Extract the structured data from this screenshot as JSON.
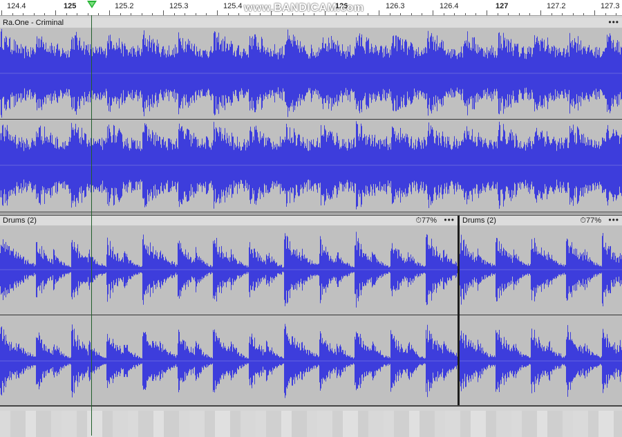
{
  "ruler": {
    "ticks": [
      {
        "label": "124.4",
        "major": false
      },
      {
        "label": "125",
        "major": true
      },
      {
        "label": "125.2",
        "major": false
      },
      {
        "label": "125.3",
        "major": false
      },
      {
        "label": "125.4",
        "major": false
      },
      {
        "label": "126",
        "major": true
      },
      {
        "label": "126.3",
        "major": false
      },
      {
        "label": "126.4",
        "major": false
      },
      {
        "label": "127",
        "major": true
      },
      {
        "label": "127.2",
        "major": false
      },
      {
        "label": "127.3",
        "major": false
      }
    ],
    "watermark": "www.BANDICAM.com"
  },
  "tracks": {
    "song": {
      "clip_name": "Ra.One - Criminal",
      "menu": "•••"
    },
    "drums": {
      "clips": [
        {
          "name": "Drums (2)",
          "speed": "77%",
          "menu": "•••"
        },
        {
          "name": "Drums (2)",
          "speed": "77%",
          "menu": "•••"
        }
      ]
    }
  },
  "colors": {
    "waveform": "#3d3ddc",
    "waveform_light": "#7272ea",
    "clip_bg": "#c0c0c0",
    "header_bg": "#dcdcdc",
    "playhead": "#28b436"
  },
  "icons": {
    "speed_icon": "clock-icon",
    "menu_icon": "more-icon",
    "playhead_icon": "playhead-triangle-icon"
  }
}
